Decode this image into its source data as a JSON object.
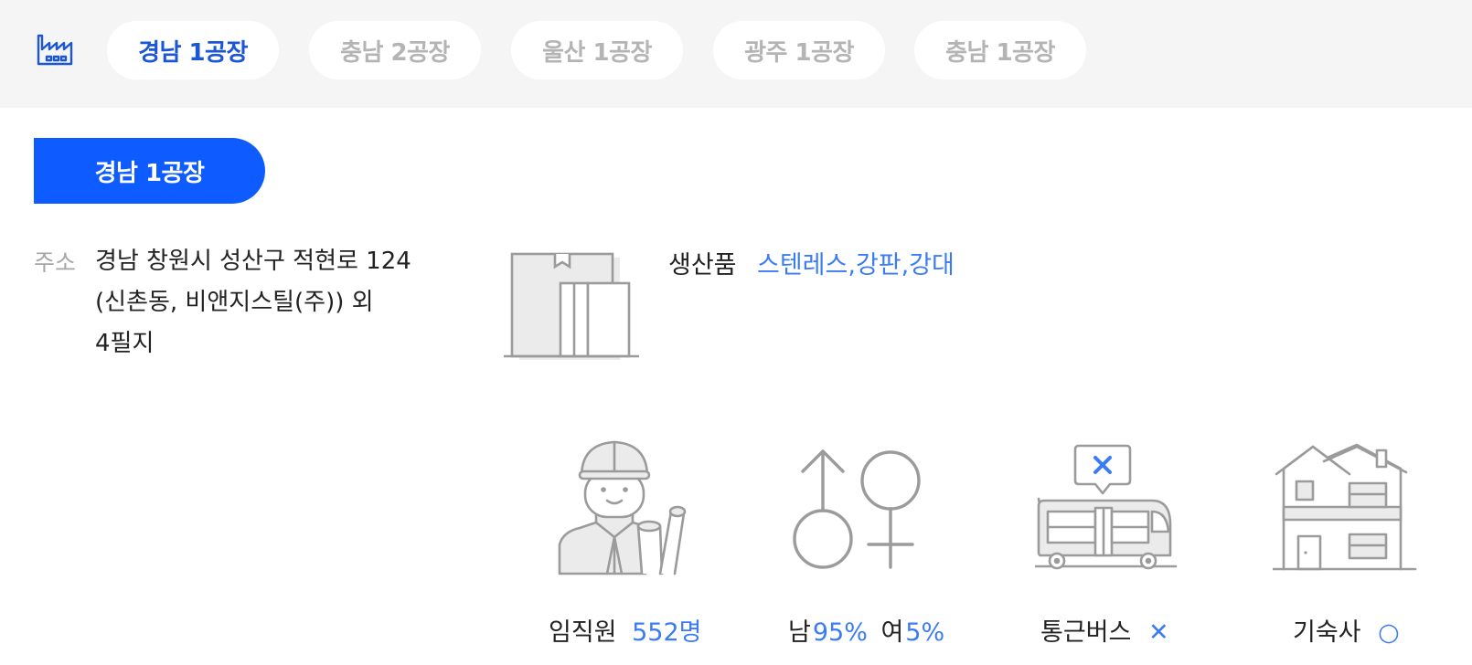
{
  "tabs": [
    {
      "label": "경남 1공장",
      "active": true
    },
    {
      "label": "충남 2공장",
      "active": false
    },
    {
      "label": "울산 1공장",
      "active": false
    },
    {
      "label": "광주 1공장",
      "active": false
    },
    {
      "label": "충남 1공장",
      "active": false
    }
  ],
  "section": {
    "title": "경남 1공장"
  },
  "address": {
    "label": "주소",
    "line1": "경남 창원시 성산구 적현로 124",
    "line2": "(신촌동, 비앤지스틸(주)) 외",
    "line3": "4필지"
  },
  "products": {
    "label": "생산품",
    "value": "스텐레스,강판,강대"
  },
  "stats": {
    "employees": {
      "label": "임직원",
      "value": "552명"
    },
    "gender": {
      "male_label": "남",
      "male_value": "95%",
      "female_label": "여",
      "female_value": "5%"
    },
    "bus": {
      "label": "통근버스",
      "status_glyph": "✕"
    },
    "dorm": {
      "label": "기숙사",
      "status_glyph": "○"
    }
  },
  "colors": {
    "accent": "#3b7cf5",
    "active_tab": "#1a56d6",
    "pill": "#0e5bff",
    "icon_gray": "#9b9b9b"
  },
  "icons": [
    "factory-icon",
    "box-icon",
    "worker-icon",
    "gender-icon",
    "bus-icon",
    "house-icon"
  ]
}
